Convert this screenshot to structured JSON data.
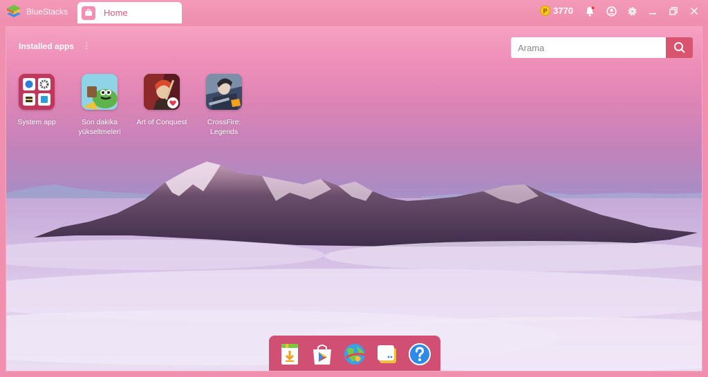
{
  "window": {
    "app_name": "BlueStacks",
    "tab_label": "Home",
    "coins": "3770",
    "coin_icon": "coin-icon",
    "icons": [
      "notification-bell-icon",
      "account-icon",
      "settings-gear-icon",
      "minimize-icon",
      "restore-icon",
      "close-icon"
    ]
  },
  "home": {
    "installed_label": "Installed apps",
    "more_label": "⋮",
    "search": {
      "placeholder": "Arama",
      "value": "",
      "icon": "search-icon"
    }
  },
  "apps": [
    {
      "label": "System app",
      "icon": "system-app-icon"
    },
    {
      "label": "Son dakika yükseltmeleri",
      "icon": "son-dakika-app-icon"
    },
    {
      "label": "Art of Conquest",
      "icon": "art-of-conquest-app-icon"
    },
    {
      "label": "CrossFire: Legends",
      "icon": "crossfire-legends-app-icon"
    }
  ],
  "dock": [
    {
      "name": "app-center-download",
      "icon": "download-icon"
    },
    {
      "name": "google-play-store",
      "icon": "play-store-icon"
    },
    {
      "name": "world-browser",
      "icon": "globe-icon"
    },
    {
      "name": "multi-instance",
      "icon": "windows-icon"
    },
    {
      "name": "help",
      "icon": "help-icon"
    }
  ],
  "colors": {
    "titlebar": "#ef8dae",
    "tab_text": "#e2577d",
    "search_button": "#d9556f",
    "dock": "#d04f73",
    "coin": "#f5c518"
  }
}
